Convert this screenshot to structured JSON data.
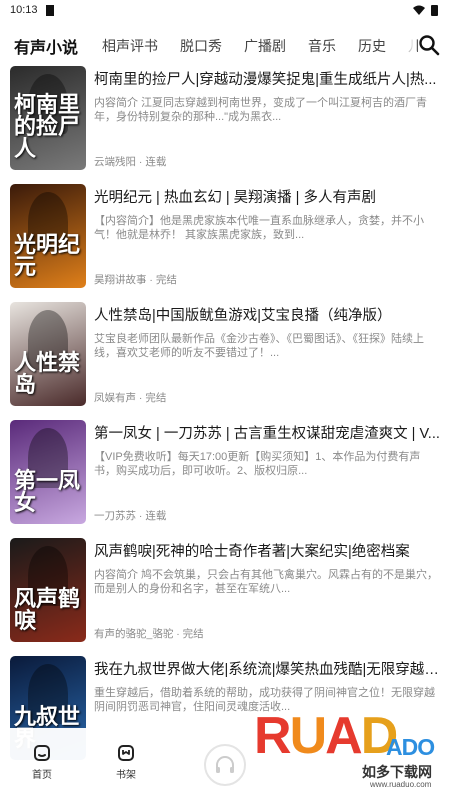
{
  "status": {
    "time": "10:13"
  },
  "tabs": [
    {
      "label": "有声小说",
      "active": true
    },
    {
      "label": "相声评书"
    },
    {
      "label": "脱口秀"
    },
    {
      "label": "广播剧"
    },
    {
      "label": "音乐"
    },
    {
      "label": "历史"
    },
    {
      "label": "儿"
    }
  ],
  "books": [
    {
      "title": "柯南里的捡尸人|穿越动漫爆笑捉鬼|重生成纸片人|热...",
      "desc": "内容简介 江夏同志穿越到柯南世界，变成了一个叫江夏柯吉的酒厂青年，身份特别复杂的那种...\"成为黑衣...",
      "meta": "云端残阳 · 连载",
      "cover_text": "柯南里的捡尸人",
      "cover_colors": [
        "#2b2b2b",
        "#7a7a7a"
      ]
    },
    {
      "title": "光明纪元 | 热血玄幻 | 昊翔演播 | 多人有声剧",
      "desc": "【内容简介】他是黑虎家族本代唯一直系血脉继承人，贪婪，并不小气！他就是林乔！ 其家族黑虎家族，致到...",
      "meta": "昊翔讲故事 · 完结",
      "cover_text": "光明纪元",
      "cover_colors": [
        "#3a1a0a",
        "#e0801a"
      ]
    },
    {
      "title": "人性禁岛|中国版鱿鱼游戏|艾宝良播（纯净版）",
      "desc": "艾宝良老师团队最新作品《金沙古卷》、《巴蜀图话》、《狂探》陆续上线，喜欢艾老师的听友不要错过了！...",
      "meta": "凤娱有声 · 完结",
      "cover_text": "人性禁岛",
      "cover_colors": [
        "#e8e4df",
        "#4a2a2a"
      ]
    },
    {
      "title": "第一凤女 | 一刀苏苏 | 古言重生权谋甜宠虐渣爽文 | V...",
      "desc": "【VIP免费收听】每天17:00更新【购买须知】1、本作品为付费有声书，购买成功后，即可收听。2、版权归原...",
      "meta": "一刀苏苏 · 连载",
      "cover_text": "第一凤女",
      "cover_colors": [
        "#5a2a7a",
        "#c8a8e0"
      ]
    },
    {
      "title": "风声鹤唳|死神的哈士奇作者著|大案纪实|绝密档案",
      "desc": "内容简介 鸠不会筑巢，只会占有其他飞禽巢穴。风霖占有的不是巢穴，而是别人的身份和名字，甚至在军统八...",
      "meta": "有声的骆驼_骆驼 · 完结",
      "cover_text": "风声鹤唳",
      "cover_colors": [
        "#1a1a1a",
        "#8a2a1a"
      ]
    },
    {
      "title": "我在九叔世界做大佬|系统流|爆笑热血残酷|无限穿越|...",
      "desc": "重生穿越后，借助着系统的帮助，成功获得了阴间神官之位！无限穿越阴间阴罚恶司神官，住阳间灵魂度活收...",
      "meta": "",
      "cover_text": "九叔世界",
      "cover_colors": [
        "#0a1a3a",
        "#2a6ab0"
      ]
    }
  ],
  "nav": [
    {
      "label": "首页"
    },
    {
      "label": "书架"
    }
  ],
  "watermark": {
    "brand_big": "RUAD",
    "brand_small": "ADO",
    "cn": "如多下载网",
    "url": "www.ruaduo.com"
  }
}
